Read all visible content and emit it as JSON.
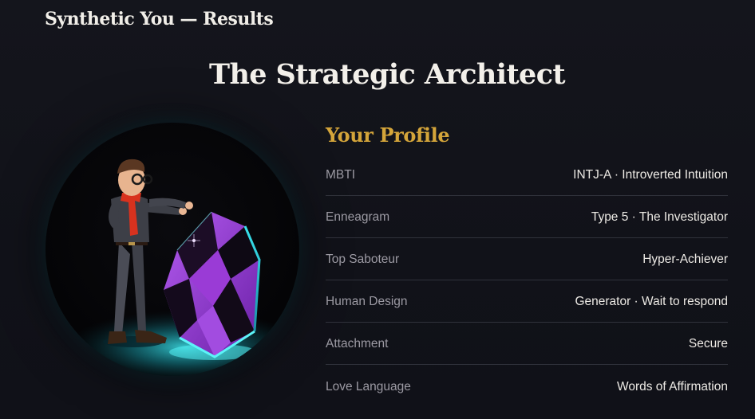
{
  "header": {
    "app_title": "Synthetic You — Results"
  },
  "result": {
    "title": "The Strategic Architect"
  },
  "avatar": {
    "icon": "architect-character-with-crystal"
  },
  "profile": {
    "heading": "Your Profile",
    "rows": [
      {
        "label": "MBTI",
        "value": "INTJ-A · Introverted Intuition"
      },
      {
        "label": "Enneagram",
        "value": "Type 5 · The Investigator"
      },
      {
        "label": "Top Saboteur",
        "value": "Hyper-Achiever"
      },
      {
        "label": "Human Design",
        "value": "Generator · Wait to respond"
      },
      {
        "label": "Attachment",
        "value": "Secure"
      },
      {
        "label": "Love Language",
        "value": "Words of Affirmation"
      }
    ]
  },
  "colors": {
    "background": "#121319",
    "accent_gold": "#d4a53a",
    "crystal_purple": "#8a2fc4",
    "glow_cyan": "#27d6e0"
  }
}
